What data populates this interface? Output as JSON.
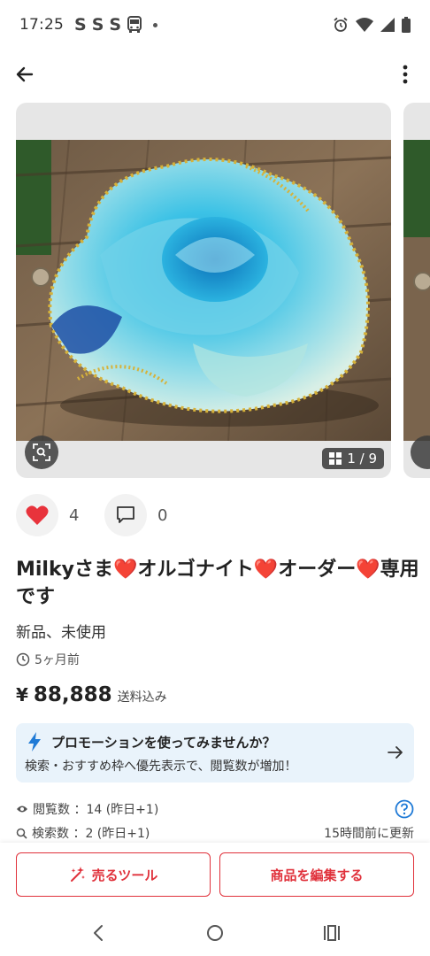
{
  "status_bar": {
    "time": "17:25",
    "notification_icons": [
      "S",
      "S",
      "S"
    ]
  },
  "product": {
    "title": "Milkyさま❤️オルゴナイト❤️オーダー❤️専用です",
    "condition": "新品、未使用",
    "posted": "5ヶ月前",
    "currency": "¥",
    "price": "88,888",
    "shipping": "送料込み",
    "image_counter": "1 / 9",
    "likes": "4",
    "comments": "0"
  },
  "promo": {
    "title": "プロモーションを使ってみませんか？",
    "description": "検索・おすすめ枠へ優先表示で、閲覧数が増加！"
  },
  "stats": {
    "views": "閲覧数 ：14 (昨日+1)",
    "searches": "検索数 ：2 (昨日+1)",
    "updated": "15時間前に更新"
  },
  "buttons": {
    "sell_tools": "売るツール",
    "edit_item": "商品を編集する"
  },
  "colors": {
    "accent": "#e0313b",
    "heart": "#e8333c",
    "promo_bg": "#e9f3fb",
    "bolt": "#1f7ad6",
    "help": "#1f7ad6"
  },
  "icons": [
    "back-arrow-icon",
    "more-vert-icon",
    "lens-icon",
    "grid-icon",
    "heart-icon",
    "comment-icon",
    "clock-icon",
    "bolt-icon",
    "arrow-right-icon",
    "eye-icon",
    "search-icon",
    "help-icon",
    "sparkle-icon",
    "nav-back-icon",
    "nav-home-icon",
    "nav-recents-icon"
  ]
}
